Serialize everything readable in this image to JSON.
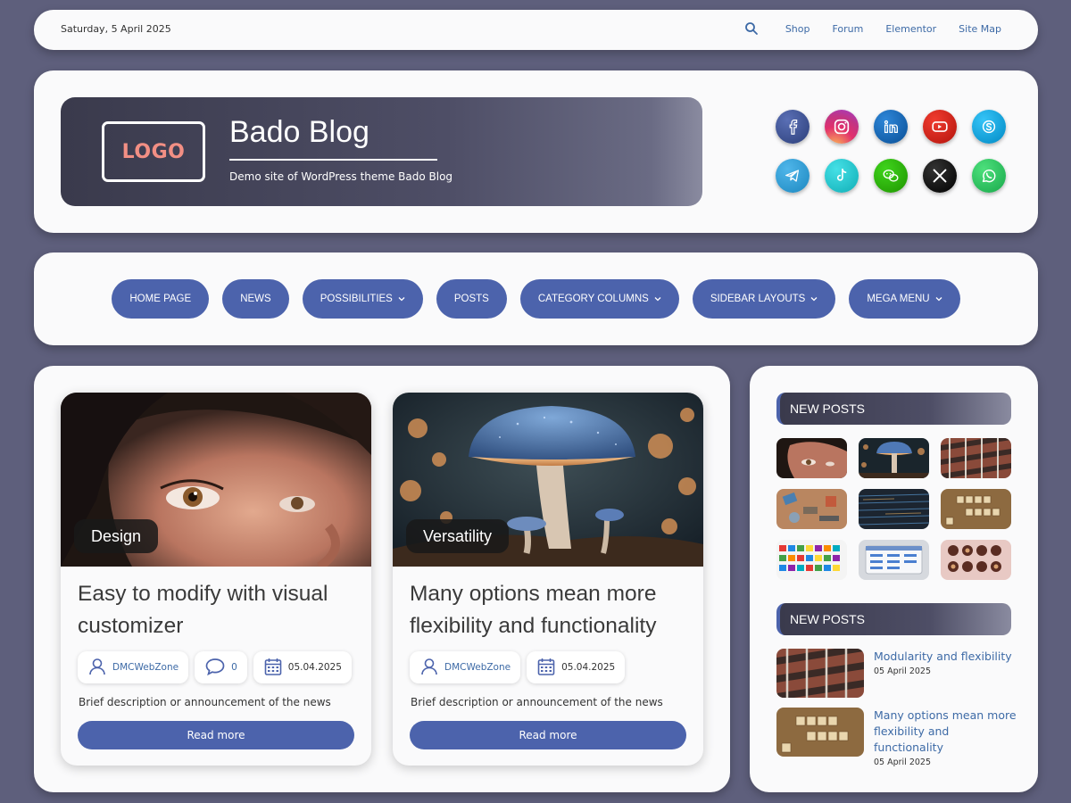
{
  "topbar": {
    "date": "Saturday, 5 April 2025",
    "links": [
      "Shop",
      "Forum",
      "Elementor",
      "Site Map"
    ]
  },
  "header": {
    "logo_text": "LOGO",
    "site_title": "Bado Blog",
    "site_description": "Demo site of WordPress theme Bado Blog",
    "socials": [
      {
        "name": "facebook-icon",
        "color": "#3b5998"
      },
      {
        "name": "instagram-icon",
        "color": "#d62976"
      },
      {
        "name": "linkedin-icon",
        "color": "#0a66c2"
      },
      {
        "name": "youtube-icon",
        "color": "#e62117"
      },
      {
        "name": "skype-icon",
        "color": "#00aff0"
      },
      {
        "name": "telegram-icon",
        "color": "#2aa3df"
      },
      {
        "name": "tiktok-icon",
        "color": "#25d1d8"
      },
      {
        "name": "wechat-icon",
        "color": "#2dc100"
      },
      {
        "name": "x-icon",
        "color": "#111111"
      },
      {
        "name": "whatsapp-icon",
        "color": "#25d366"
      }
    ]
  },
  "nav": {
    "items": [
      {
        "label": "HOME PAGE",
        "dropdown": false
      },
      {
        "label": "NEWS",
        "dropdown": false
      },
      {
        "label": "POSSIBILITIES",
        "dropdown": true
      },
      {
        "label": "POSTS",
        "dropdown": false
      },
      {
        "label": "CATEGORY COLUMNS",
        "dropdown": true
      },
      {
        "label": "SIDEBAR LAYOUTS",
        "dropdown": true
      },
      {
        "label": "MEGA MENU",
        "dropdown": true
      }
    ],
    "chevron": "⌄"
  },
  "posts": [
    {
      "category": "Design",
      "title": "Easy to modify with visual customizer",
      "author": "DMCWebZone",
      "comments": "0",
      "date": "05.04.2025",
      "description": "Brief description or announcement of the news",
      "read_more": "Read more"
    },
    {
      "category": "Versatility",
      "title": "Many options mean more flexibility and functionality",
      "author": "DMCWebZone",
      "date": "05.04.2025",
      "description": "Brief description or announcement of the news",
      "read_more": "Read more"
    }
  ],
  "sidebar": {
    "widget1_title": "NEW POSTS",
    "widget2_title": "NEW POSTS",
    "recent": [
      {
        "title": "Modularity and flexibility",
        "date": "05 April 2025"
      },
      {
        "title": "Many options mean more flexibility and functionality",
        "date": "05 April 2025"
      }
    ]
  },
  "colors": {
    "background": "#5e5f7c",
    "accent": "#4c63ac",
    "link": "#3d6aa6"
  }
}
